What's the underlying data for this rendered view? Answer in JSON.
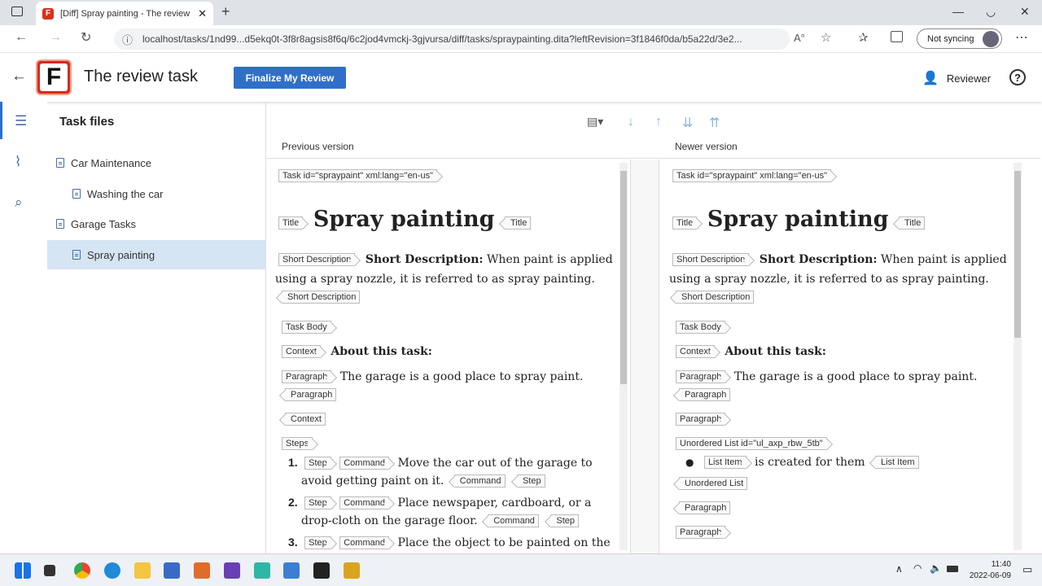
{
  "browser": {
    "tab_title": "[Diff] Spray painting - The review task",
    "url": "localhost/tasks/1nd99...d5ekq0t-3f8r8agsis8f6q/6c2jod4vmckj-3gjvursa/diff/tasks/spraypainting.dita?leftRevision=3f1846f0da/b5a22d/3e2...",
    "sync_label": "Not syncing"
  },
  "app": {
    "logo_letter": "F",
    "title": "The review task",
    "finalize_label": "Finalize My Review",
    "user_label": "Reviewer",
    "help_label": "?"
  },
  "tree": {
    "heading": "Task files",
    "items": [
      {
        "label": "Car Maintenance"
      },
      {
        "label": "Washing the car"
      },
      {
        "label": "Garage Tasks"
      },
      {
        "label": "Spray painting"
      }
    ]
  },
  "diff": {
    "left_header": "Previous version",
    "right_header": "Newer version",
    "left": {
      "task_tag": "Task id=\"spraypaint\" xml:lang=\"en-us\"",
      "title_tag": "Title",
      "title": "Spray painting",
      "shortdesc_tag": "Short Description",
      "shortdesc_label": "Short Description:",
      "shortdesc_text1": "When paint is applied",
      "shortdesc_text2": "using a spray nozzle, it is referred to as spray painting.",
      "taskbody_tag": "Task Body",
      "context_tag": "Context",
      "context_heading": "About this task:",
      "paragraph_tag": "Paragraph",
      "paragraph_text": "The garage is a good place to spray paint.",
      "steps_tag": "Steps",
      "step_tag": "Step",
      "command_tag": "Command",
      "steps": [
        {
          "num": "1.",
          "text1": "Move the car out of the garage to",
          "text2": "avoid getting paint on it."
        },
        {
          "num": "2.",
          "text1": "Place newspaper, cardboard, or a",
          "text2": "drop-cloth on the garage floor."
        },
        {
          "num": "3.",
          "text1": "Place the object to be painted on the"
        }
      ]
    },
    "right": {
      "task_tag": "Task id=\"spraypaint\" xml:lang=\"en-us\"",
      "title_tag": "Title",
      "title": "Spray painting",
      "shortdesc_tag": "Short Description",
      "shortdesc_label": "Short Description:",
      "shortdesc_text1": "When paint is applied",
      "shortdesc_text2": "using a spray nozzle, it is referred to as spray painting.",
      "taskbody_tag": "Task Body",
      "context_tag": "Context",
      "context_heading": "About this task:",
      "paragraph_tag": "Paragraph",
      "paragraph_text": "The garage is a good place to spray paint.",
      "ul_tag": "Unordered List id=\"ul_axp_rbw_5tb\"",
      "listitem_tag": "List Item",
      "listitem_text": "is created for them",
      "ul_close_tag": "Unordered List"
    }
  },
  "taskbar": {
    "time": "11:40",
    "date": "2022-06-09"
  },
  "colors": {
    "accent": "#2f6fca",
    "selection": "#d6e5f3",
    "logo": "#d52b1e"
  }
}
